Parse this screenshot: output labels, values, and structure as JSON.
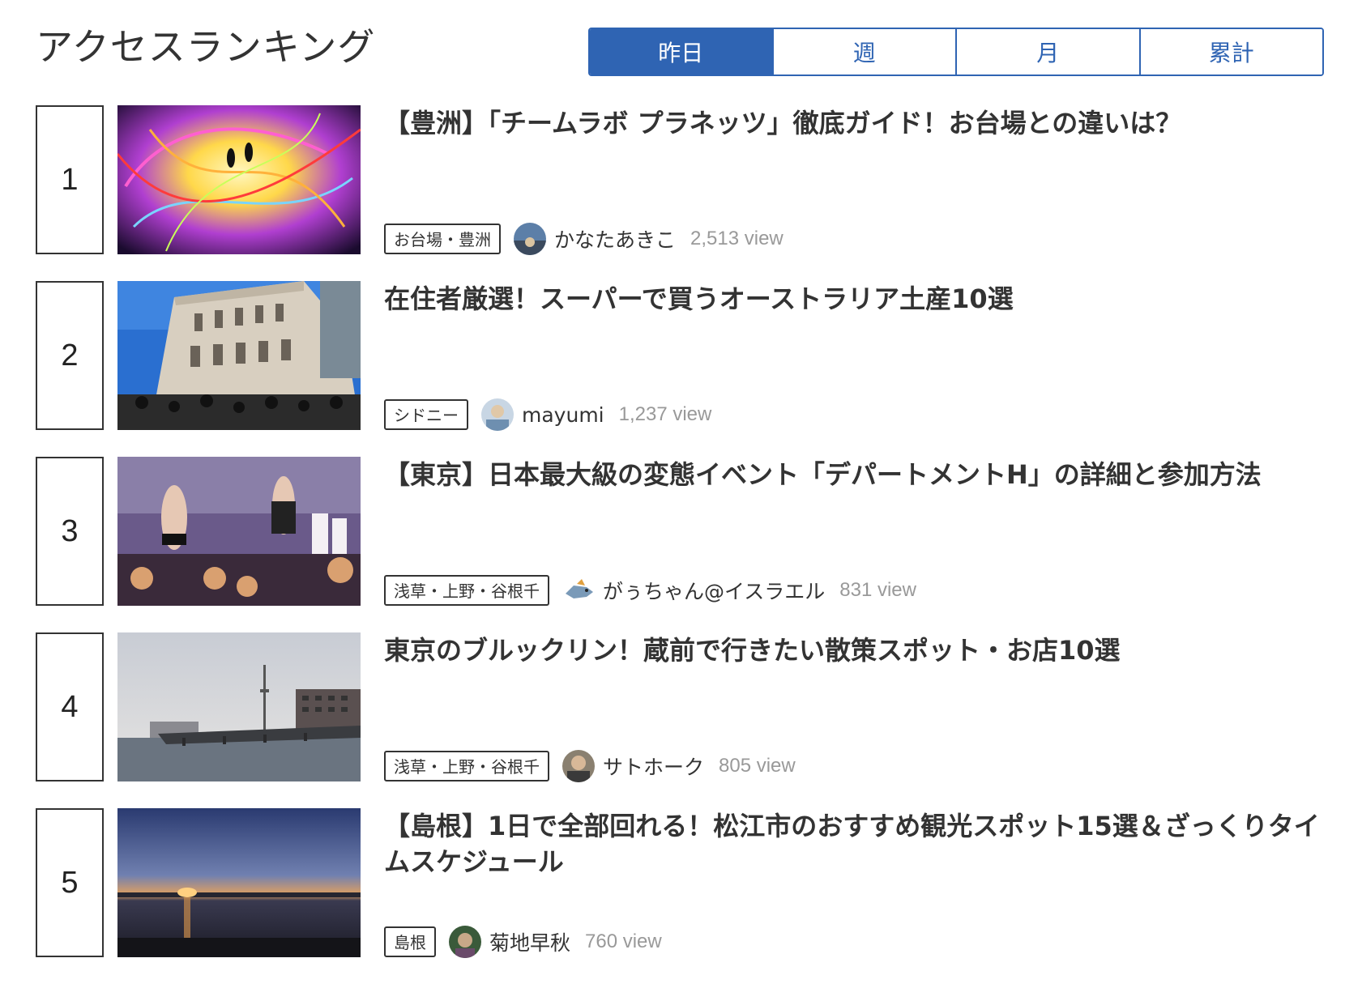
{
  "header": {
    "title": "アクセスランキング"
  },
  "tabs": [
    {
      "label": "昨日",
      "active": true
    },
    {
      "label": "週",
      "active": false
    },
    {
      "label": "月",
      "active": false
    },
    {
      "label": "累計",
      "active": false
    }
  ],
  "ranking": [
    {
      "rank": "1",
      "title": "【豊洲】「チームラボ プラネッツ」徹底ガイド！お台場との違いは？",
      "tag": "お台場・豊洲",
      "author": "かなたあきこ",
      "views": "2,513 view"
    },
    {
      "rank": "2",
      "title": "在住者厳選！スーパーで買うオーストラリア土産10選",
      "tag": "シドニー",
      "author": "mayumi",
      "views": "1,237 view"
    },
    {
      "rank": "3",
      "title": "【東京】日本最大級の変態イベント「デパートメントH」の詳細と参加方法",
      "tag": "浅草・上野・谷根千",
      "author": "がぅちゃん@イスラエル",
      "views": "831 view"
    },
    {
      "rank": "4",
      "title": "東京のブルックリン！蔵前で行きたい散策スポット・お店10選",
      "tag": "浅草・上野・谷根千",
      "author": "サトホーク",
      "views": "805 view"
    },
    {
      "rank": "5",
      "title": "【島根】1日で全部回れる！松江市のおすすめ観光スポット15選＆ざっくりタイムスケジュール",
      "tag": "島根",
      "author": "菊地早秋",
      "views": "760 view"
    }
  ],
  "colors": {
    "accent": "#2f64b3",
    "text": "#333333",
    "muted": "#999999"
  }
}
